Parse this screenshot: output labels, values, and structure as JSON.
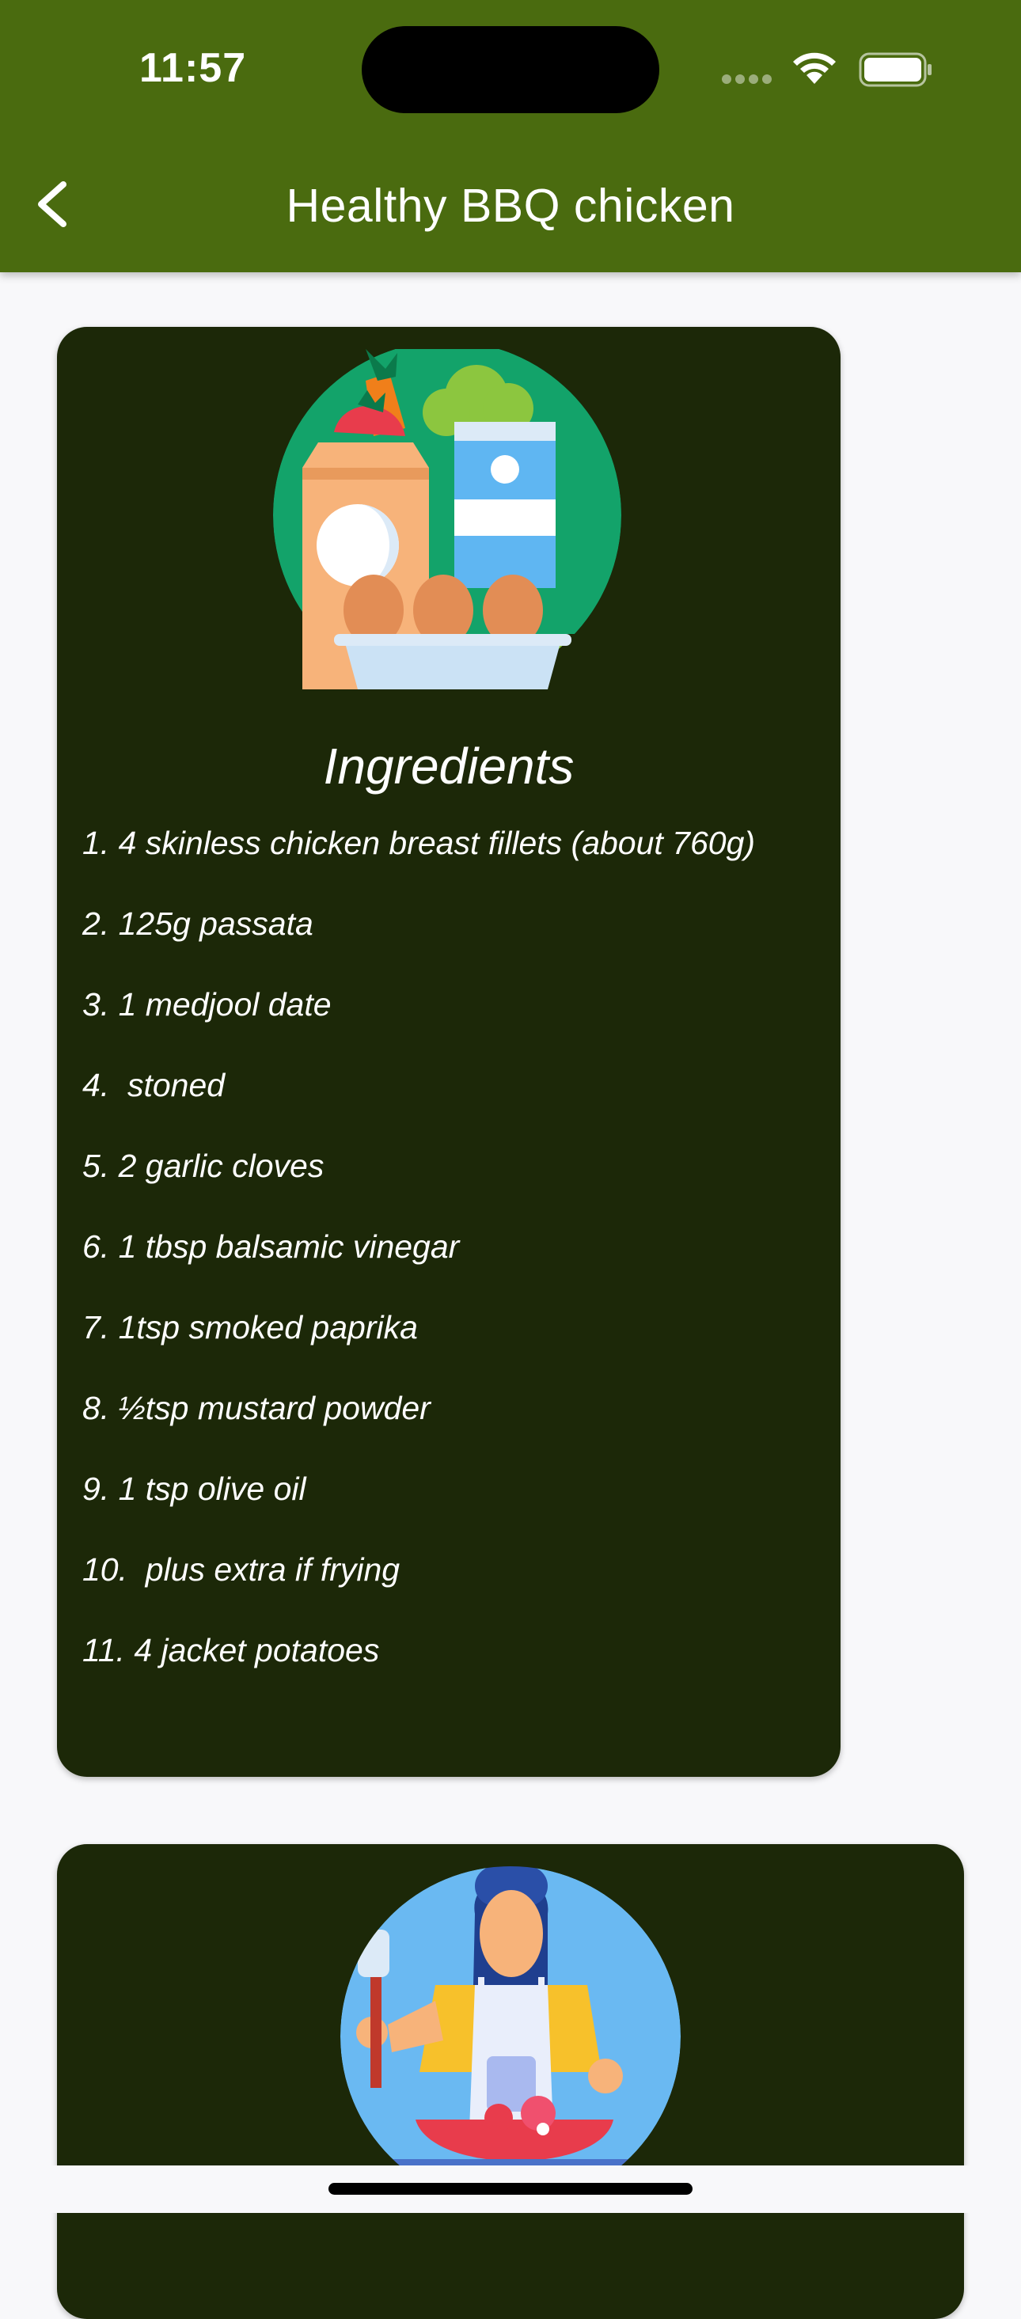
{
  "status": {
    "time": "11:57"
  },
  "appbar": {
    "title": "Healthy BBQ chicken",
    "back_icon": "chevron-left-icon"
  },
  "ingredients": {
    "heading": "Ingredients",
    "items": [
      "1. 4 skinless chicken breast fillets (about 760g)",
      "2. 125g passata",
      "3. 1 medjool date",
      "4.  stoned",
      "5. 2 garlic cloves",
      "6. 1 tbsp balsamic vinegar",
      "7. 1tsp smoked paprika",
      "8. ½tsp mustard powder",
      "9. 1 tsp olive oil",
      "10.  plus extra if frying",
      "11. 4 jacket potatoes"
    ]
  },
  "colors": {
    "appbar": "#4a6b0f",
    "card": "#1c2808",
    "background": "#f8f8fa"
  }
}
